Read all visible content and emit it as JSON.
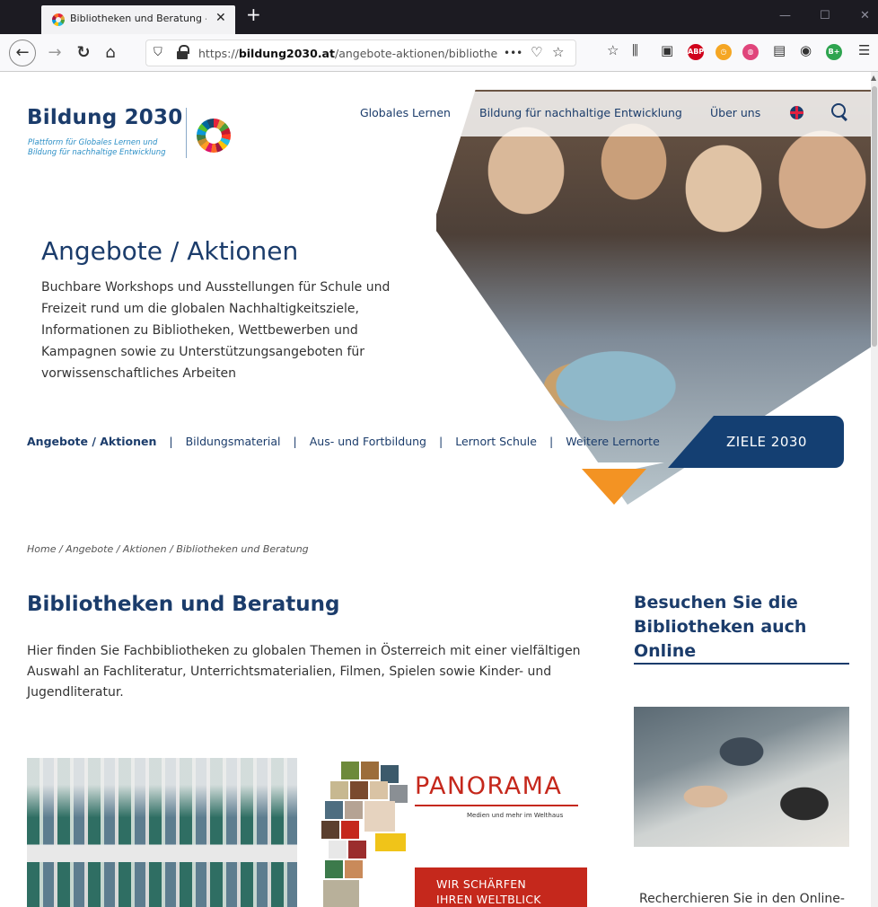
{
  "browser": {
    "tab_title": "Bibliotheken und Beratung – Bi",
    "tab_close": "✕",
    "new_tab": "+",
    "url_host": "bildung2030.at",
    "url_prefix": "https://",
    "url_path": "/angebote-aktionen/bibliotheken",
    "url_more": "•••",
    "ext_abp": "ABP",
    "ext_b": "B+"
  },
  "header": {
    "logo_title": "Bildung 2030",
    "logo_sub_line1": "Plattform für Globales Lernen und",
    "logo_sub_line2": "Bildung für nachhaltige Entwicklung",
    "nav": [
      "Globales Lernen",
      "Bildung für nachhaltige Entwicklung",
      "Über uns"
    ]
  },
  "hero": {
    "title": "Angebote / Aktionen",
    "description": "Buchbare Workshops und Ausstellungen für Schule und Freizeit rund um die globalen Nachhaltigkeitsziele, Informationen zu Bibliotheken, Wettbewerben und Kampagnen sowie zu Unterstützungsangeboten für vorwissenschaftliches Arbeiten"
  },
  "subnav": {
    "items": [
      "Angebote / Aktionen",
      "Bildungsmaterial",
      "Aus- und Fortbildung",
      "Lernort Schule",
      "Weitere Lernorte"
    ],
    "separator": "|",
    "cta": "ZIELE 2030"
  },
  "breadcrumb": "Home / Angebote / Aktionen / Bibliotheken und Beratung",
  "main": {
    "title": "Bibliotheken und Beratung",
    "intro": "Hier finden Sie Fachbibliotheken zu globalen Themen in Österreich mit einer vielfältigen Auswahl an Fachliteratur, Unterrichtsmaterialien, Filmen, Spielen sowie Kinder- und Jugendliteratur.",
    "panorama": {
      "word": "PANORAMA",
      "sub": "Medien und mehr im Welthaus",
      "box_line1": "WIR SCHÄRFEN",
      "box_line2": "IHREN WELTBLICK"
    }
  },
  "sidebar": {
    "title": "Besuchen Sie die Bibliotheken auch Online",
    "text": "Recherchieren Sie in den Online-"
  },
  "colors": {
    "brand_navy": "#1b3c6b",
    "brand_blue": "#2c8fc6",
    "panorama_red": "#c5281c",
    "cta_bg": "#143f72",
    "accent_orange": "#f39323"
  }
}
